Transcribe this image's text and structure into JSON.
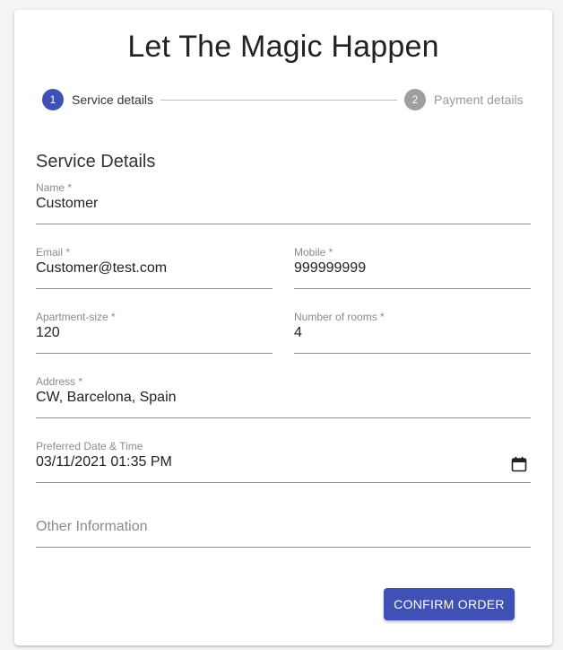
{
  "title": "Let The Magic Happen",
  "stepper": {
    "steps": [
      {
        "number": "1",
        "label": "Service details",
        "state": "active",
        "color": "#3f51b5"
      },
      {
        "number": "2",
        "label": "Payment details",
        "state": "inactive",
        "color": "#9e9e9e"
      }
    ]
  },
  "section_title": "Service Details",
  "form": {
    "name": {
      "label": "Name *",
      "value": "Customer"
    },
    "email": {
      "label": "Email *",
      "value": "Customer@test.com"
    },
    "mobile": {
      "label": "Mobile *",
      "value": "999999999"
    },
    "apartment_size": {
      "label": "Apartment-size *",
      "value": "120"
    },
    "rooms": {
      "label": "Number of rooms *",
      "value": "4"
    },
    "address": {
      "label": "Address *",
      "value": "CW, Barcelona, Spain"
    },
    "datetime": {
      "label": "Preferred Date & Time",
      "value": "03/11/2021 01:35 PM",
      "icon": "calendar-icon"
    },
    "other": {
      "placeholder": "Other Information",
      "value": ""
    }
  },
  "actions": {
    "confirm_label": "CONFIRM ORDER",
    "accent_color": "#3f51b5"
  }
}
